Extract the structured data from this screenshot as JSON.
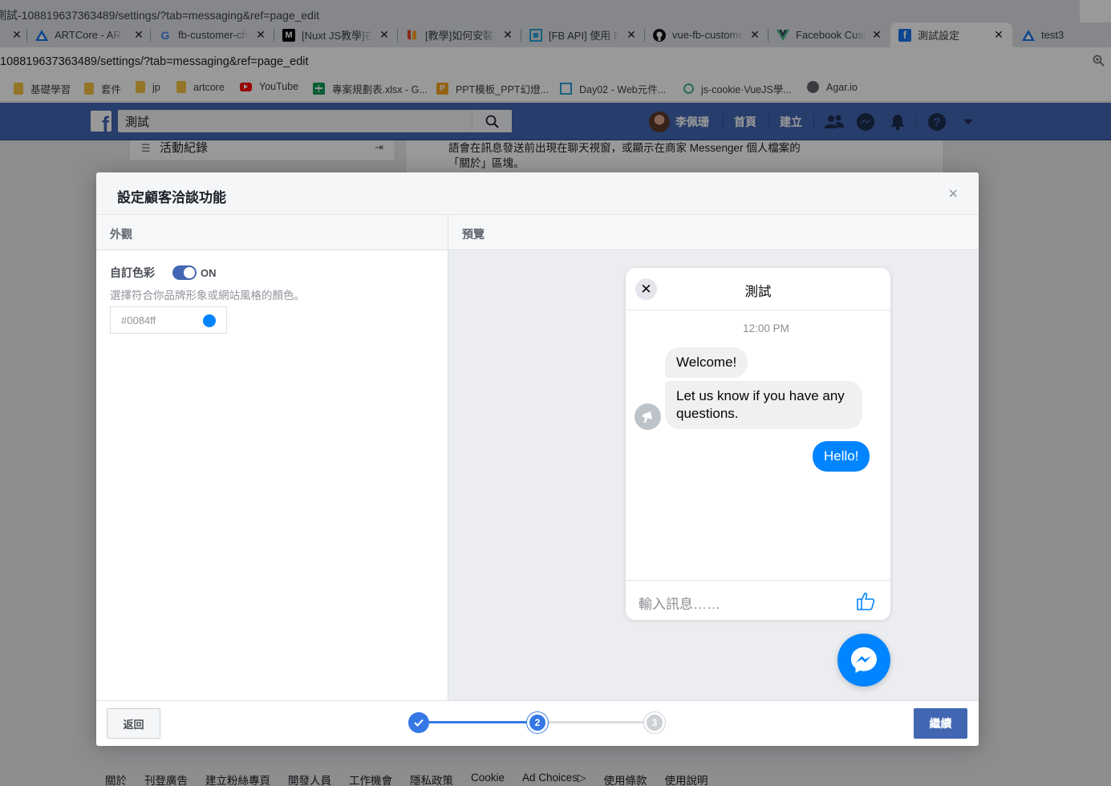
{
  "browser": {
    "window_title": "測試-108819637363489/settings/?tab=messaging&ref=page_edit",
    "tabs": [
      {
        "title": "",
        "icon": "partial-tab-icon"
      },
      {
        "title": "ARTCore - ARTCore",
        "icon": "artcore-icon"
      },
      {
        "title": "fb-customer-chat",
        "icon": "google-icon"
      },
      {
        "title": "[Nuxt JS教學]在Nuxt",
        "icon": "medium-icon"
      },
      {
        "title": "[教學]如何安裝插件",
        "icon": "gitlab-icon"
      },
      {
        "title": "[FB API] 使用 FB SDK",
        "icon": "ithelp-icon"
      },
      {
        "title": "vue-fb-customer-chat",
        "icon": "github-icon"
      },
      {
        "title": "Facebook Customer",
        "icon": "vue-icon"
      },
      {
        "title": "測試設定",
        "icon": "facebook-icon"
      },
      {
        "title": "test3",
        "icon": "artcore-icon"
      }
    ],
    "url": "108819637363489/settings/?tab=messaging&ref=page_edit",
    "bookmarks": [
      {
        "label": "基礎學習",
        "icon": "folder-icon"
      },
      {
        "label": "套件",
        "icon": "folder-icon"
      },
      {
        "label": "jp",
        "icon": "folder-icon"
      },
      {
        "label": "artcore",
        "icon": "folder-icon"
      },
      {
        "label": "YouTube",
        "icon": "youtube-icon"
      },
      {
        "label": "專案規劃表.xlsx - G...",
        "icon": "sheets-icon"
      },
      {
        "label": "PPT模板_PPT幻燈...",
        "icon": "ppt-icon"
      },
      {
        "label": "Day02 - Web元件...",
        "icon": "ithelp-icon"
      },
      {
        "label": "js-cookie·VueJS學...",
        "icon": "cookie-icon"
      },
      {
        "label": "Agar.io",
        "icon": "globe-icon"
      }
    ]
  },
  "fb_header": {
    "search_value": "測試",
    "user_name": "李佩珊",
    "nav_home": "首頁",
    "nav_create": "建立"
  },
  "background_page": {
    "side_item": "活動紀錄",
    "card_text": "語會在訊息發送前出現在聊天視窗，或顯示在商家 Messenger 個人檔案的「關於」區塊。",
    "footer_links": [
      "關於",
      "刊登廣告",
      "建立粉絲專頁",
      "開發人員",
      "工作機會",
      "隱私政策",
      "Cookie",
      "Ad Choices",
      "使用條款",
      "使用說明"
    ]
  },
  "dialog": {
    "title": "設定顧客洽談功能",
    "close_symbol": "×",
    "left_header": "外觀",
    "right_header": "預覽",
    "custom_color_label": "自訂色彩",
    "toggle_state": "ON",
    "hint": "選擇符合你品牌形象或網站風格的顏色。",
    "color_value": "#0084ff",
    "back_button": "返回",
    "next_button": "繼續",
    "steps": [
      {
        "label": "",
        "state": "done"
      },
      {
        "label": "2",
        "state": "current"
      },
      {
        "label": "3",
        "state": "pending"
      }
    ]
  },
  "preview": {
    "page_name": "測試",
    "close_symbol": "✕",
    "time": "12:00 PM",
    "messages": [
      {
        "from": "page",
        "text": "Welcome!"
      },
      {
        "from": "page",
        "text": "Let us know if you have any questions."
      },
      {
        "from": "user",
        "text": "Hello!"
      }
    ],
    "input_placeholder": "輸入訊息……"
  },
  "colors": {
    "fb_blue": "#4267b2",
    "messenger_blue": "#0084ff",
    "step_done": "#3578e5",
    "step_pending": "#ccd0d5"
  }
}
